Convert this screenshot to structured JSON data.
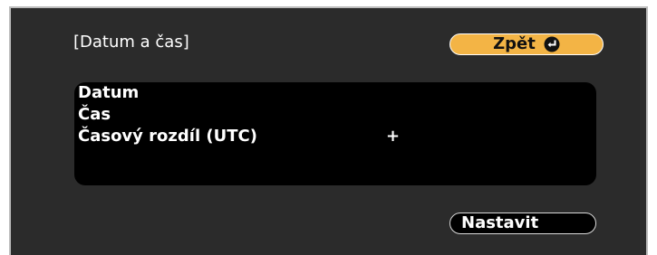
{
  "dialog": {
    "title": "[Datum a čas]",
    "back_label": "Zpět",
    "back_icon": "enter-icon",
    "set_label": "Nastavit"
  },
  "rows": [
    {
      "label": "Datum",
      "value": ""
    },
    {
      "label": "Čas",
      "value": ""
    },
    {
      "label": "Časový rozdíl (UTC)",
      "value": "+"
    },
    {
      "label": "",
      "value": ""
    }
  ],
  "colors": {
    "panel_background": "#2b2b2b",
    "list_background": "#000000",
    "back_button_accent": "#f3b445",
    "text": "#ffffff"
  }
}
